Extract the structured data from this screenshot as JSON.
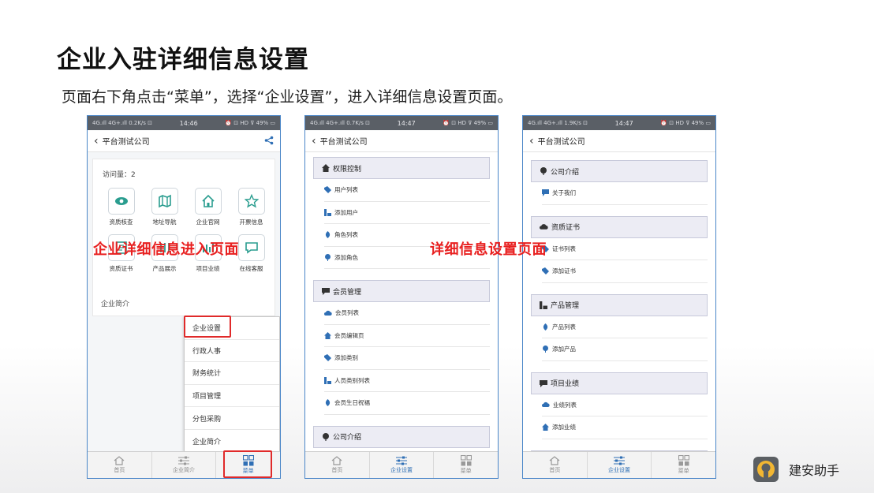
{
  "slide": {
    "title": "企业入驻详细信息设置",
    "subtitle": "页面右下角点击“菜单”，选择“企业设置”，进入详细信息设置页面。"
  },
  "annotations": {
    "left": "企业详细信息进入页面",
    "right": "详细信息设置页面"
  },
  "phones": [
    {
      "status": {
        "left": "4G.ıll 4G+.ıll 0.2K/s ⊡",
        "time": "14:46",
        "right": "⏰ ⊡ HD ⊽ 49% ▭"
      },
      "title": "平台测试公司",
      "visits": "访问量：2",
      "grid": [
        "资质核查",
        "地址导航",
        "企业官网",
        "开票信息",
        "资质证书",
        "产品展示",
        "项目业绩",
        "在线客服"
      ],
      "section": "企业简介",
      "popup": [
        "企业设置",
        "行政人事",
        "财务统计",
        "项目管理",
        "分包采购",
        "企业简介"
      ],
      "tabs": [
        "首页",
        "企业简介",
        "菜单"
      ]
    },
    {
      "status": {
        "left": "4G.ıll 4G+.ıll 0.7K/s ⊡",
        "time": "14:47",
        "right": "⏰ ⊡ HD ⊽ 49% ▭"
      },
      "title": "平台测试公司",
      "groups": [
        {
          "head": "权限控制",
          "items": [
            "用户列表",
            "添加用户",
            "角色列表",
            "添加角色"
          ]
        },
        {
          "head": "会员管理",
          "items": [
            "会员列表",
            "会员编辑页",
            "添加类别",
            "人员类别列表",
            "会员生日祝福"
          ]
        },
        {
          "head": "公司介绍",
          "items": []
        }
      ],
      "tabs": [
        "首页",
        "企业设置",
        "菜单"
      ]
    },
    {
      "status": {
        "left": "4G.ıll 4G+.ıll 1.9K/s ⊡",
        "time": "14:47",
        "right": "⏰ ⊡ HD ⊽ 49% ▭"
      },
      "title": "平台测试公司",
      "groups": [
        {
          "head": "公司介绍",
          "items": [
            "关于我们"
          ]
        },
        {
          "head": "资质证书",
          "items": [
            "证书列表",
            "添加证书"
          ]
        },
        {
          "head": "产品管理",
          "items": [
            "产品列表",
            "添加产品"
          ]
        },
        {
          "head": "项目业绩",
          "items": [
            "业绩列表",
            "添加业绩"
          ]
        },
        {
          "head": "",
          "items": []
        }
      ],
      "tabs": [
        "首页",
        "企业设置",
        "菜单"
      ]
    }
  ],
  "brand": {
    "name": "建安助手"
  },
  "colors": {
    "accent": "#2f6fb5",
    "highlight": "#e02a2a",
    "icon_teal": "#2a9d8f"
  }
}
